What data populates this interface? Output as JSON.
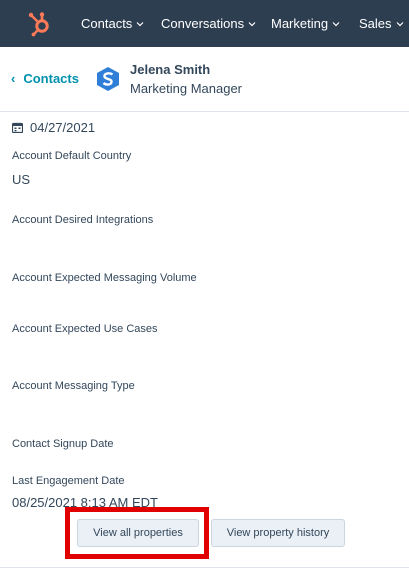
{
  "topnav": {
    "brand_icon": "hubspot-sprocket-icon",
    "items": [
      {
        "label": "Contacts",
        "icon": "chevron-down-icon"
      },
      {
        "label": "Conversations",
        "icon": "chevron-down-icon"
      },
      {
        "label": "Marketing",
        "icon": "chevron-down-icon"
      },
      {
        "label": "Sales",
        "icon": "chevron-down-icon"
      }
    ],
    "background": "#2d3e50",
    "brand_color": "#ff7a59"
  },
  "contact": {
    "back_label": "Contacts",
    "name": "Jelena Smith",
    "title": "Marketing Manager",
    "company_icon": "company-logo-icon",
    "link_color": "#0091ae"
  },
  "properties": {
    "first_value": "04/27/2021",
    "items": [
      {
        "label": "Account Default Country",
        "value": "US"
      },
      {
        "label": "Account Desired Integrations",
        "value": ""
      },
      {
        "label": "Account Expected Messaging Volume",
        "value": ""
      },
      {
        "label": "Account Expected Use Cases",
        "value": ""
      },
      {
        "label": "Account Messaging Type",
        "value": ""
      },
      {
        "label": "Contact Signup Date",
        "value": ""
      },
      {
        "label": "Last Engagement Date",
        "value": "08/25/2021 8:13 AM EDT"
      }
    ]
  },
  "actions": {
    "view_all_label": "View all properties",
    "view_history_label": "View property history",
    "highlight_color": "#e00000"
  }
}
